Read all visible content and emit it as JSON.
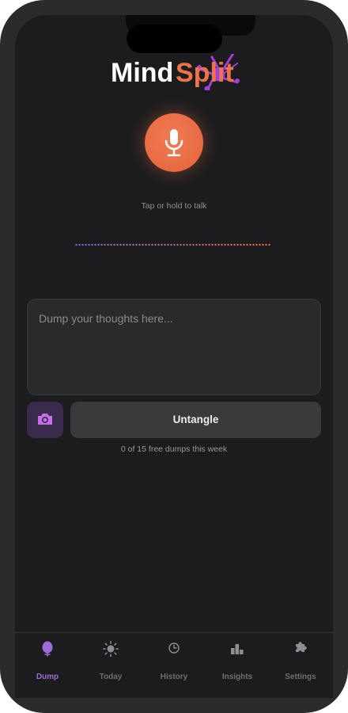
{
  "app": {
    "logo_part1": "Mind",
    "logo_part2": "Split",
    "brand_colors": {
      "accent": "#e86a40",
      "purple": "#9b6bd6",
      "background": "#1c1c1e"
    }
  },
  "recorder": {
    "mic_icon": "microphone-icon",
    "hint": "Tap or hold to talk"
  },
  "composer": {
    "placeholder": "Dump your thoughts here...",
    "value": "",
    "camera_icon": "camera-icon",
    "submit_label": "Untangle",
    "quota": "0 of 15 free dumps this week"
  },
  "tabs": [
    {
      "label": "Dump",
      "icon": "head-icon",
      "active": true
    },
    {
      "label": "Today",
      "icon": "sun-icon",
      "active": false
    },
    {
      "label": "History",
      "icon": "clock-icon",
      "active": false
    },
    {
      "label": "Insights",
      "icon": "bar-chart-icon",
      "active": false
    },
    {
      "label": "Settings",
      "icon": "puzzle-icon",
      "active": false
    }
  ]
}
